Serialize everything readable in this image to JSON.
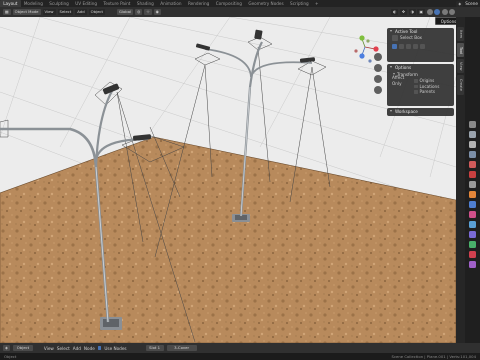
{
  "top_tabs": [
    "Layout",
    "Modeling",
    "Sculpting",
    "UV Editing",
    "Texture Paint",
    "Shading",
    "Animation",
    "Rendering",
    "Compositing",
    "Geometry Nodes",
    "Scripting",
    "+"
  ],
  "active_tab_index": 0,
  "scene_name": "Scene",
  "viewport_header": {
    "mode": "Object Mode",
    "view_menu": "View",
    "select_menu": "Select",
    "add_menu": "Add",
    "object_menu": "Object",
    "transform_orientation": "Global"
  },
  "options_tooltip": "Options",
  "active_tool_panel": {
    "title": "Active Tool",
    "tool_name": "Select Box"
  },
  "options_panel": {
    "title": "Options",
    "transform_label": "Transform",
    "affect_only_label": "Affect Only",
    "checks": [
      "Origins",
      "Locations",
      "Parents"
    ]
  },
  "workspace_panel": {
    "title": "Workspace"
  },
  "side_tabs": [
    "Item",
    "Tool",
    "View",
    "Create"
  ],
  "bottom_bar": {
    "editor_mode": "Object",
    "view": "View",
    "select": "Select",
    "add": "Add",
    "node": "Node",
    "use_nodes": "Use Nodes",
    "slot": "Slot 1",
    "material": "3-Cover"
  },
  "status": {
    "left": "Object",
    "right": "Scene Collection | Plane.001 | Verts:101,004"
  },
  "colors": {
    "accent": "#4772b3",
    "ground_light": "#c49766",
    "ground_dark": "#8c6540",
    "backdrop": "#ececec"
  }
}
